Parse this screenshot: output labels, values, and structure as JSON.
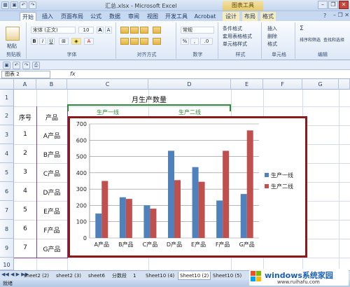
{
  "window": {
    "title": "汇总.xlsx - Microsoft Excel",
    "context_tab_title": "图表工具"
  },
  "tabs": [
    "开始",
    "插入",
    "页面布局",
    "公式",
    "数据",
    "审阅",
    "视图",
    "开发工具",
    "Acrobat",
    "设计",
    "布局",
    "格式"
  ],
  "ribbon": {
    "clipboard": {
      "paste": "粘贴",
      "label": "剪贴板"
    },
    "font": {
      "name": "宋体 (正文)",
      "size": "10",
      "bold": "B",
      "italic": "I",
      "underline": "U",
      "grow": "A",
      "shrink": "A",
      "label": "字体"
    },
    "alignment": {
      "label": "对齐方式"
    },
    "number": {
      "format": "常规",
      "percent": "%",
      "comma": ",",
      "label": "数字"
    },
    "styles": {
      "conditional": "条件格式",
      "table": "套用表格格式",
      "cell": "单元格样式",
      "label": "样式"
    },
    "cells": {
      "insert": "插入",
      "delete": "删除",
      "format": "格式",
      "label": "单元格"
    },
    "editing": {
      "sum": "Σ",
      "sort": "排序和筛选",
      "find": "查找和选择",
      "label": "编辑"
    }
  },
  "formula_bar": {
    "name_box": "图表 2",
    "fx": "fx",
    "content": ""
  },
  "grid": {
    "columns": [
      "A",
      "B",
      "C",
      "D",
      "E",
      "F",
      "G"
    ],
    "rows": [
      "1",
      "2",
      "3",
      "4",
      "5",
      "6",
      "7",
      "8",
      "9",
      "10"
    ],
    "title": "月生产数量",
    "header_seq": "序号",
    "header_product": "产品",
    "header_line1": "生产一线",
    "header_line2": "生产二线",
    "seq": [
      "1",
      "2",
      "3",
      "4",
      "5",
      "6",
      "7"
    ],
    "products": [
      "A产品",
      "B产品",
      "C产品",
      "D产品",
      "E产品",
      "F产品",
      "G产品"
    ]
  },
  "chart_data": {
    "type": "bar",
    "categories": [
      "A产品",
      "B产品",
      "C产品",
      "D产品",
      "E产品",
      "F产品",
      "G产品"
    ],
    "series": [
      {
        "name": "生产一线",
        "color": "#4f81bd",
        "values": [
          150,
          250,
          200,
          535,
          435,
          230,
          270
        ]
      },
      {
        "name": "生产二线",
        "color": "#c0504d",
        "values": [
          350,
          240,
          180,
          355,
          345,
          535,
          660
        ]
      }
    ],
    "ylim": [
      0,
      700
    ],
    "yticks": [
      "0",
      "100",
      "200",
      "300",
      "400",
      "500",
      "600",
      "700"
    ],
    "grid": true,
    "legend": "right"
  },
  "sheet_tabs": [
    "sheet2 (2)",
    "sheet2 (3)",
    "sheet6",
    "分数段",
    "1",
    "Sheet10 (4)",
    "Sheet10 (2)",
    "Sheet10 (5)"
  ],
  "status": {
    "ready": "就绪"
  },
  "watermark": {
    "brand": "windows系统家园",
    "url": "www.ruihafu.com"
  }
}
